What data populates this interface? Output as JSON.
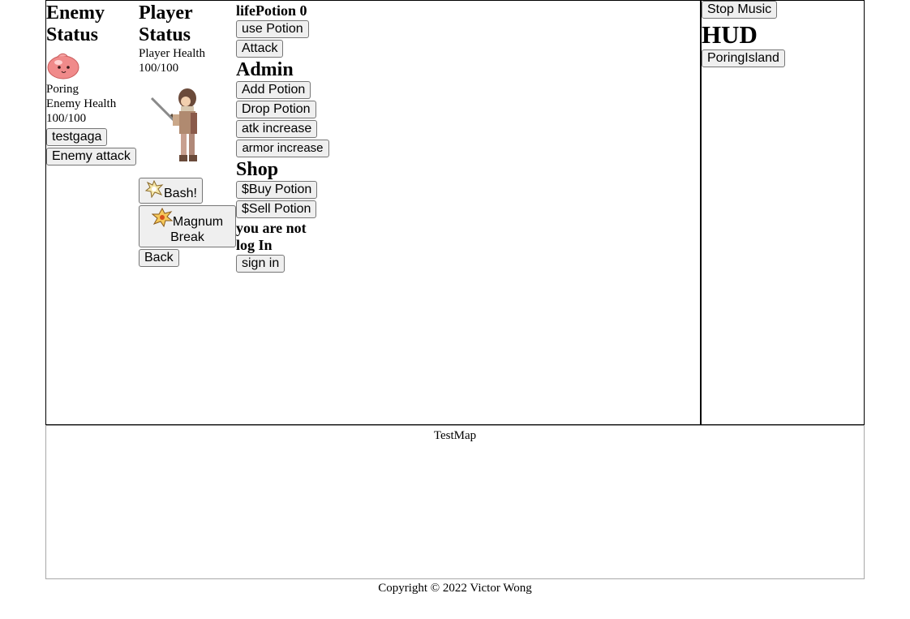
{
  "enemy": {
    "heading": "Enemy Status",
    "name": "Poring",
    "health_label": "Enemy Health",
    "health_value": "100/100",
    "buttons": {
      "testgaga": "testgaga",
      "enemy_attack": "Enemy attack"
    }
  },
  "player": {
    "heading": "Player Status",
    "health_label": "Player Health",
    "health_value": "100/100",
    "skills": {
      "bash": "Bash!",
      "magnum_break": "Magnum Break",
      "back": "Back"
    }
  },
  "actions": {
    "life_potion_label": "lifePotion 0",
    "use_potion": "use Potion",
    "attack": "Attack"
  },
  "admin": {
    "heading": "Admin",
    "add_potion": "Add Potion",
    "drop_potion": "Drop Potion",
    "atk_increase": "atk increase",
    "armor_increase": "armor increase"
  },
  "shop": {
    "heading": "Shop",
    "buy_potion": "$Buy Potion",
    "sell_potion": "$Sell Potion"
  },
  "auth": {
    "status": "you are not log In",
    "sign_in": "sign in"
  },
  "hud": {
    "stop_music": "Stop Music",
    "heading": "HUD",
    "poring_island": "PoringIsland"
  },
  "map": {
    "label": "TestMap"
  },
  "footer": {
    "copyright": "Copyright © 2022 Victor Wong"
  },
  "colors": {
    "poring_body": "#f08a8a",
    "button_bg": "#efefef",
    "button_border": "#767676"
  }
}
